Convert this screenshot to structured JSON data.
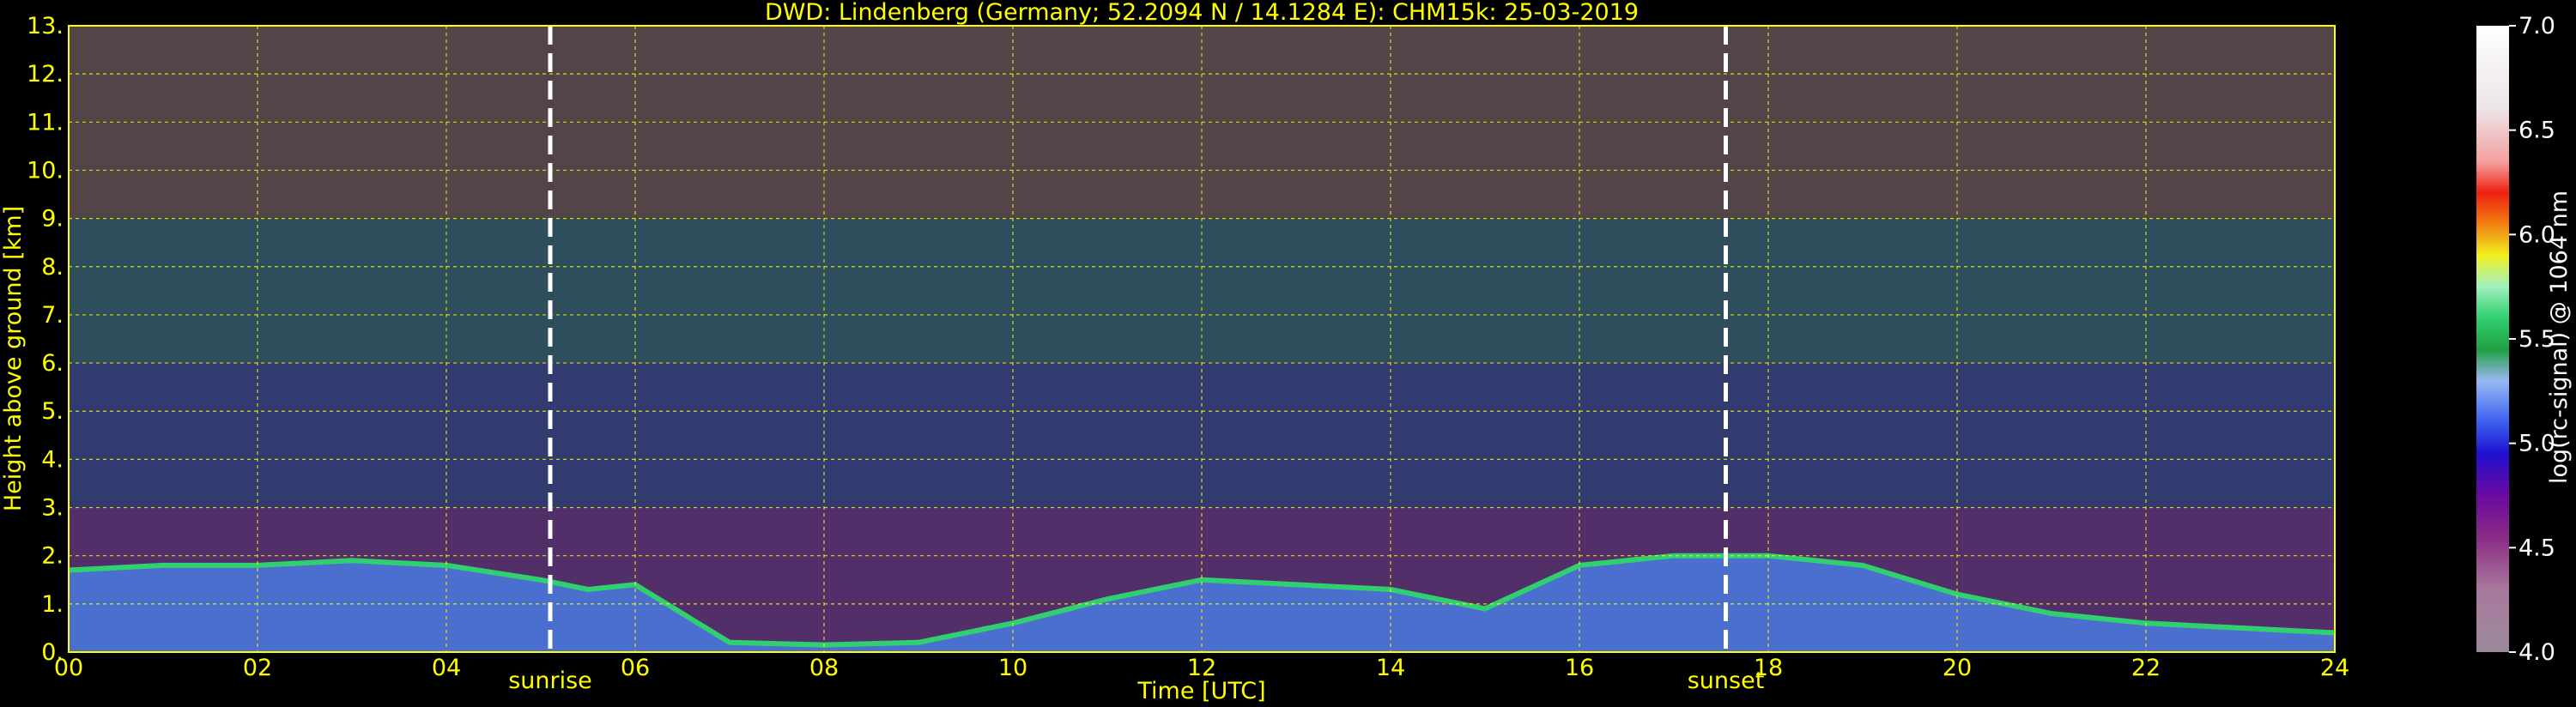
{
  "chart_data": {
    "type": "heatmap",
    "title": "DWD: Lindenberg (Germany; 52.2094 N / 14.1284 E):    CHM15k: 25-03-2019",
    "xlabel": "Time [UTC]",
    "ylabel": "Height above ground [km]",
    "xlim": [
      0,
      24
    ],
    "ylim": [
      0,
      13
    ],
    "x_ticks": [
      "00",
      "02",
      "04",
      "06",
      "08",
      "10",
      "12",
      "14",
      "16",
      "18",
      "20",
      "22",
      "24"
    ],
    "y_ticks": [
      "0.",
      "1.",
      "2.",
      "3.",
      "4.",
      "5.",
      "6.",
      "7.",
      "8.",
      "9.",
      "10.",
      "11.",
      "12.",
      "13."
    ],
    "grid": true,
    "grid_color": "#ffff00",
    "annotations": [
      {
        "label": "sunrise",
        "x": 5.1
      },
      {
        "label": "sunset",
        "x": 17.55
      }
    ],
    "colorbar": {
      "label": "log(rc-signal) @ 1064 nm",
      "range": [
        4.0,
        7.0
      ],
      "ticks": [
        "4.0",
        "4.5",
        "5.0",
        "5.5",
        "6.0",
        "6.5",
        "7.0"
      ],
      "stops": [
        {
          "v": 4.0,
          "c": "#9a8a9c"
        },
        {
          "v": 4.3,
          "c": "#a8799c"
        },
        {
          "v": 4.55,
          "c": "#8a2b86"
        },
        {
          "v": 4.75,
          "c": "#6a0aa0"
        },
        {
          "v": 4.95,
          "c": "#2010d0"
        },
        {
          "v": 5.1,
          "c": "#3a60f0"
        },
        {
          "v": 5.3,
          "c": "#9ab8f4"
        },
        {
          "v": 5.45,
          "c": "#20a040"
        },
        {
          "v": 5.6,
          "c": "#30d070"
        },
        {
          "v": 5.75,
          "c": "#a0f0c0"
        },
        {
          "v": 5.9,
          "c": "#f0f020"
        },
        {
          "v": 6.05,
          "c": "#f08010"
        },
        {
          "v": 6.2,
          "c": "#f02010"
        },
        {
          "v": 6.35,
          "c": "#f4a0a0"
        },
        {
          "v": 6.6,
          "c": "#ece4e8"
        },
        {
          "v": 7.0,
          "c": "#ffffff"
        }
      ]
    },
    "series": [
      {
        "x": [
          0,
          1,
          2,
          3,
          4,
          5,
          5.5,
          6,
          7,
          8,
          9,
          10,
          11,
          12,
          13,
          14,
          15,
          16,
          17,
          18,
          19,
          20,
          21,
          22,
          23,
          24
        ],
        "values": [
          1.7,
          1.8,
          1.8,
          1.9,
          1.8,
          1.5,
          1.3,
          1.4,
          0.2,
          0.15,
          0.2,
          0.6,
          1.1,
          1.5,
          1.4,
          1.3,
          0.9,
          1.8,
          2.0,
          2.0,
          1.8,
          1.2,
          0.8,
          0.6,
          0.5,
          0.4
        ]
      }
    ]
  }
}
